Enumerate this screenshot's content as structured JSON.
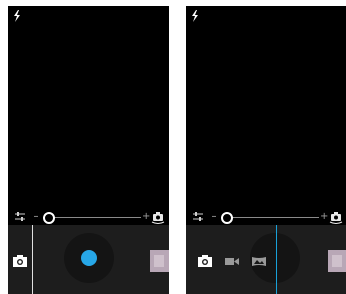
{
  "screens": [
    {
      "id": "left",
      "zoom": {
        "minus": "–",
        "plus": "+"
      },
      "modes": [
        {
          "name": "photo",
          "icon": "camera-icon",
          "active": true
        }
      ],
      "shutter_color": "#27a7e8",
      "state": "default"
    },
    {
      "id": "right",
      "zoom": {
        "minus": "–",
        "plus": "+"
      },
      "modes": [
        {
          "name": "photo",
          "icon": "camera-icon",
          "active": true
        },
        {
          "name": "video",
          "icon": "video-icon",
          "active": false
        },
        {
          "name": "panorama",
          "icon": "panorama-icon",
          "active": false
        }
      ],
      "state": "mode-switcher-open"
    }
  ],
  "colors": {
    "background": "#000000",
    "bottom_bar": "#1d1d1d",
    "accent": "#19a1d9"
  }
}
